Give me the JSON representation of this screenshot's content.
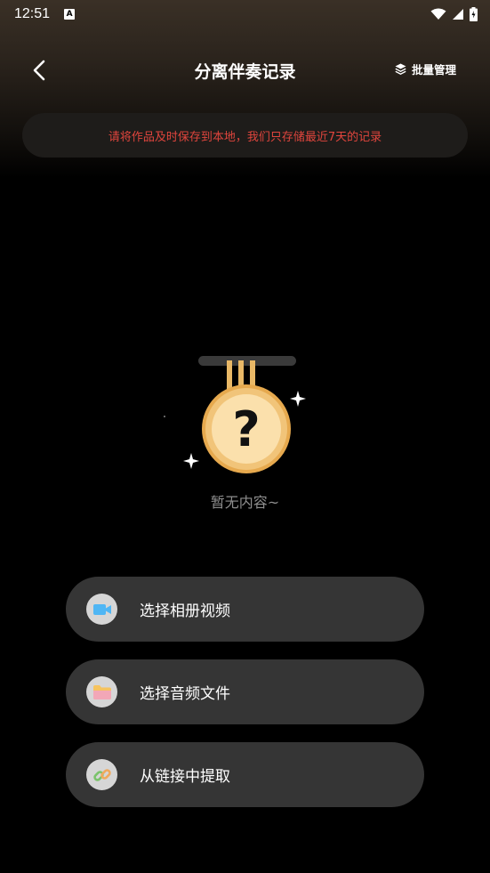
{
  "status_bar": {
    "time": "12:51",
    "notification_letter": "A"
  },
  "header": {
    "title": "分离伴奏记录",
    "batch_label": "批量管理"
  },
  "notice": {
    "text": "请将作品及时保存到本地，我们只存储最近7天的记录"
  },
  "empty_state": {
    "text": "暂无内容~"
  },
  "actions": [
    {
      "label": "选择相册视频",
      "icon": "video-camera-icon"
    },
    {
      "label": "选择音频文件",
      "icon": "folder-icon"
    },
    {
      "label": "从链接中提取",
      "icon": "link-icon"
    }
  ],
  "colors": {
    "notice_text": "#e0453d",
    "button_bg": "#353535",
    "medal_gold": "#f3c97a"
  }
}
